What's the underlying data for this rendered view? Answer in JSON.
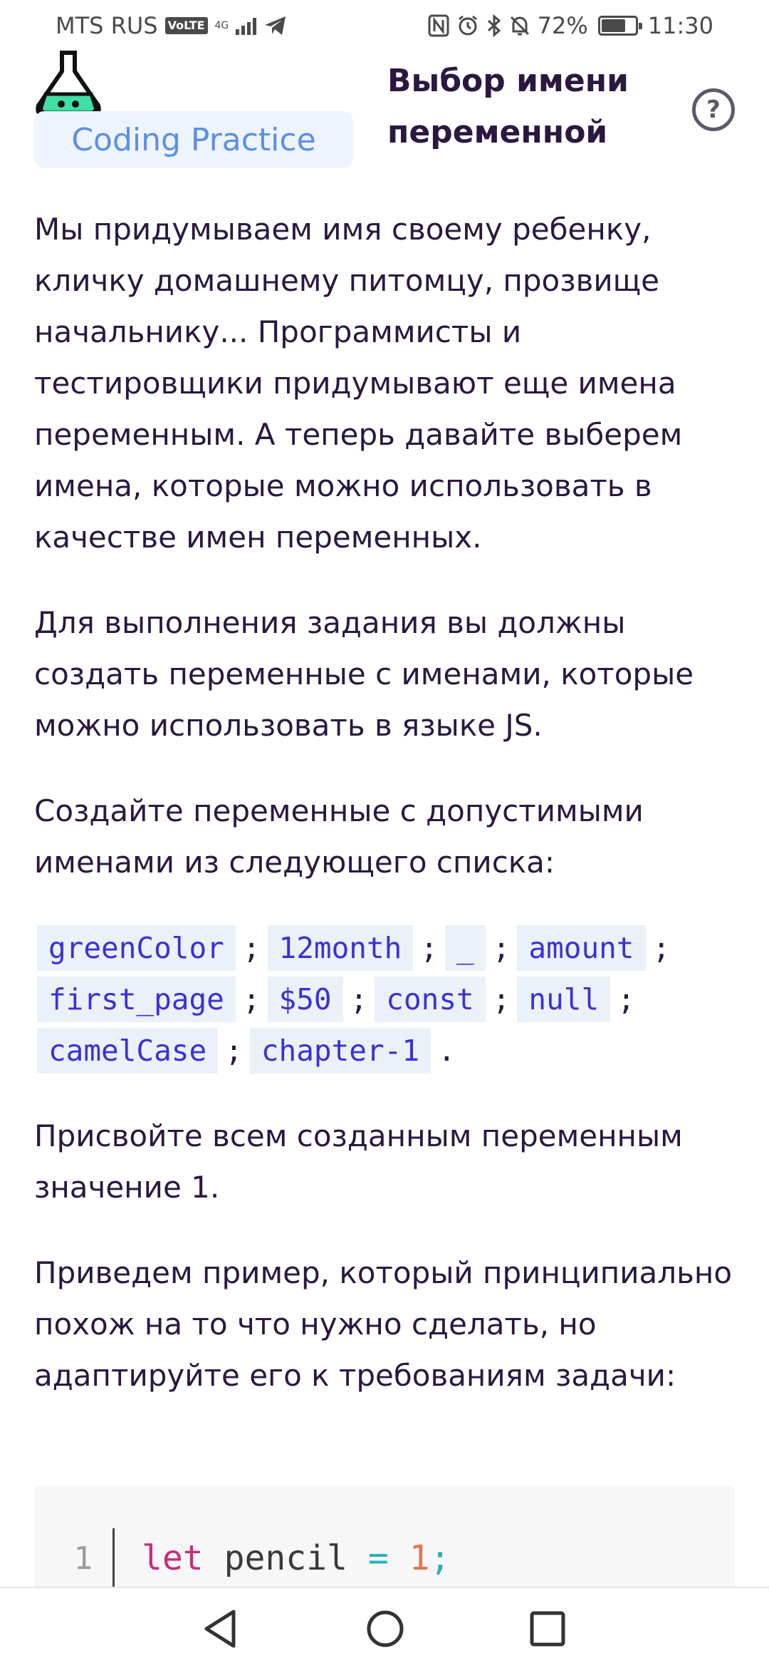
{
  "status_bar": {
    "carrier": "MTS RUS",
    "volte": "VoLTE",
    "network": "4G",
    "battery": "72%",
    "battery_level": 0.72,
    "time": "11:30",
    "icons": [
      "telegram-icon",
      "nfc-icon",
      "alarm-icon",
      "bluetooth-icon",
      "mute-icon",
      "battery-icon"
    ]
  },
  "header": {
    "brand": "Coding Practice",
    "title": "Выбор имени переменной",
    "help_label": "?",
    "colors": {
      "brand_text": "#5b8fe6",
      "brand_bg": "#eef4fd",
      "flask_liquid": "#3ee0a3"
    }
  },
  "content": {
    "p1": "Мы придумываем имя своему ребенку, кличку домашнему питомцу, прозвище начальнику... Программисты и тестировщики придумывают еще имена переменным. А теперь давайте выберем имена, которые можно использовать в качестве имен переменных.",
    "p2": "Для выполнения задания вы должны создать переменные с именами, которые можно использовать в языке JS.",
    "p3": "Создайте переменные с допустимыми именами из следующего списка:",
    "names": [
      "greenColor",
      "12month",
      "_",
      "amount",
      "first_page",
      "$50",
      "const",
      "null",
      "camelCase",
      "chapter-1"
    ],
    "separator": ";",
    "terminator": ".",
    "p4": "Присвойте всем созданным переменным значение 1.",
    "p5": "Приведем пример, который принципиально похож на то что нужно сделать, но адаптируйте его к требованиям задачи:"
  },
  "code": {
    "line_number": "1",
    "keyword": "let",
    "identifier": "pencil",
    "operator": "=",
    "value": "1",
    "end": ";"
  },
  "nav": {
    "buttons": [
      "back-icon",
      "home-icon",
      "recents-icon"
    ]
  }
}
